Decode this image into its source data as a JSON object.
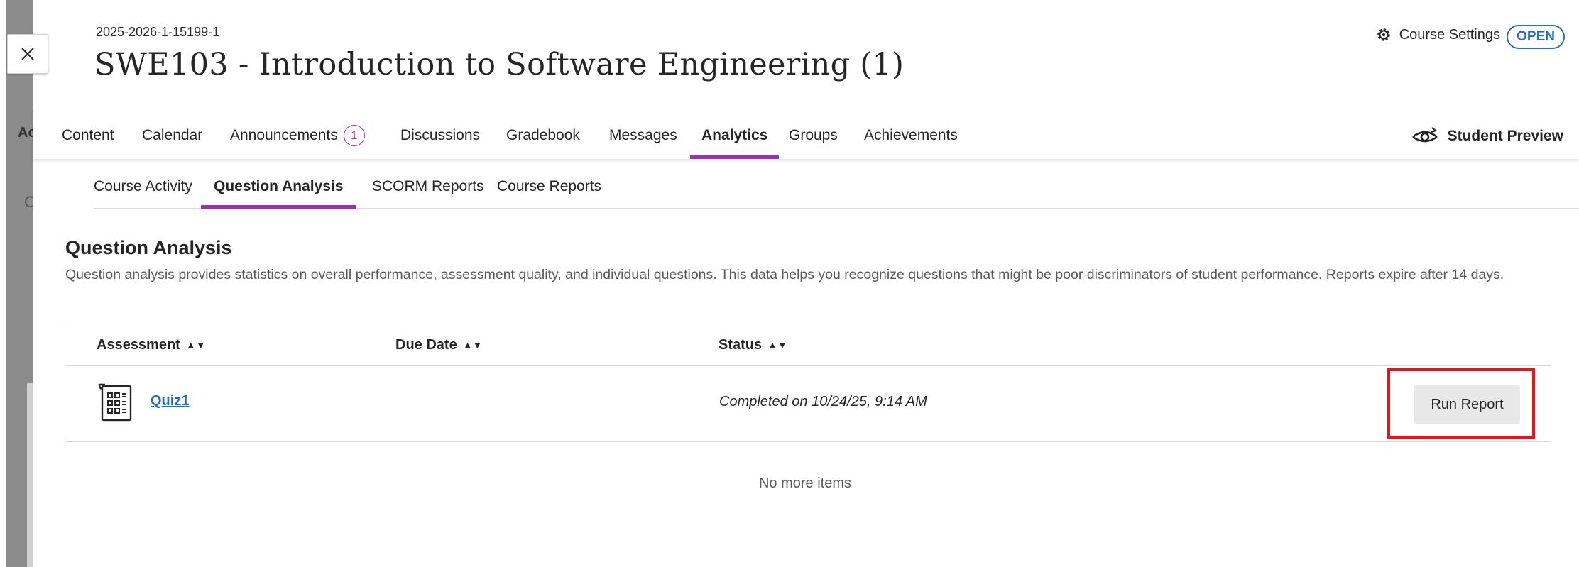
{
  "background": {
    "fragment_a": "Ac",
    "fragment_c": "C"
  },
  "header": {
    "course_id": "2025-2026-1-15199-1",
    "course_title": "SWE103 - Introduction to Software Engineering (1)",
    "settings_label": "Course Settings",
    "status_badge": "OPEN"
  },
  "nav": {
    "items": [
      {
        "label": "Content"
      },
      {
        "label": "Calendar"
      },
      {
        "label": "Announcements",
        "badge": "1"
      },
      {
        "label": "Discussions"
      },
      {
        "label": "Gradebook"
      },
      {
        "label": "Messages"
      },
      {
        "label": "Analytics",
        "active": true
      },
      {
        "label": "Groups"
      },
      {
        "label": "Achievements"
      }
    ],
    "student_preview": "Student Preview"
  },
  "subnav": {
    "items": [
      {
        "label": "Course Activity"
      },
      {
        "label": "Question Analysis",
        "active": true
      },
      {
        "label": "SCORM Reports"
      },
      {
        "label": "Course Reports"
      }
    ]
  },
  "section": {
    "title": "Question Analysis",
    "description": "Question analysis provides statistics on overall performance, assessment quality, and individual questions. This data helps you recognize questions that might be poor discriminators of student performance. Reports expire after 14 days."
  },
  "table": {
    "columns": [
      "Assessment",
      "Due Date",
      "Status"
    ],
    "rows": [
      {
        "assessment": "Quiz1",
        "due_date": "",
        "status": "Completed on 10/24/25, 9:14 AM",
        "action": "Run Report"
      }
    ],
    "footer": "No more items"
  },
  "colors": {
    "accent": "#9d2fb0",
    "link": "#1f6fb2",
    "badge_blue": "#2a6fb8",
    "highlight": "#e8141c"
  },
  "icons": {
    "close": "close-icon",
    "settings": "gear-icon",
    "preview": "eye-icon",
    "assessment": "assessment-icon",
    "sort": "sort-icon"
  }
}
